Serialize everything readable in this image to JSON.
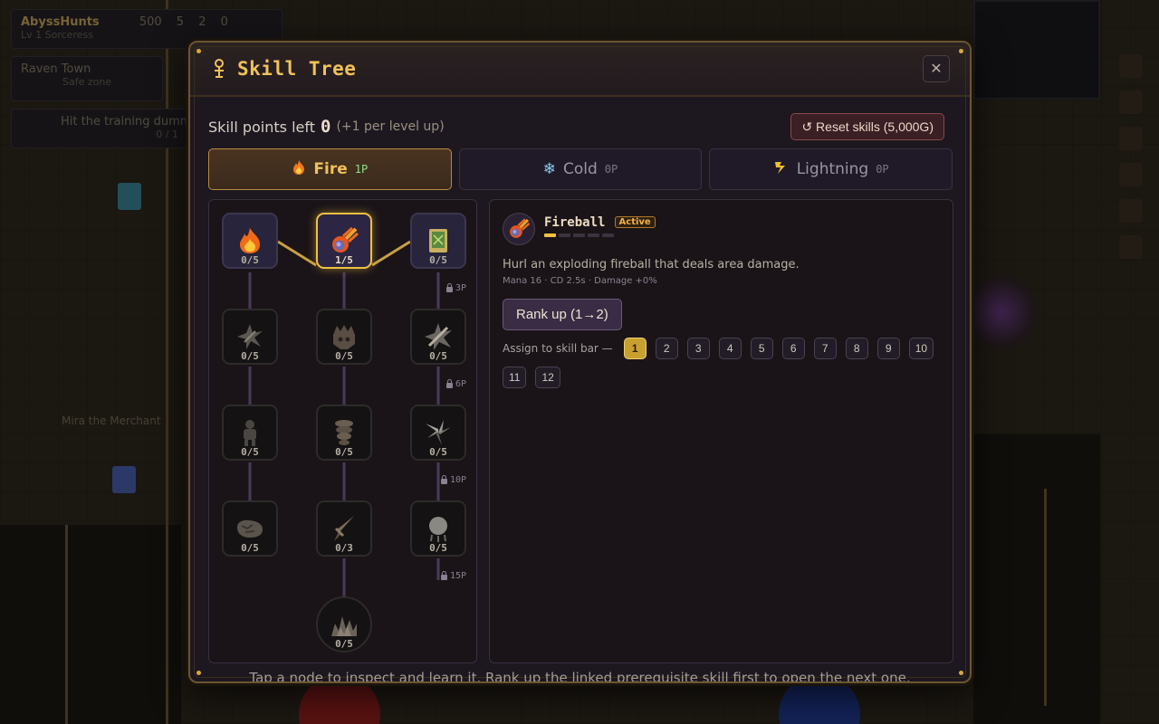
{
  "hud": {
    "player_name": "AbyssHunts",
    "player_class": "Lv 1 Sorceress",
    "gold": "500",
    "res1": "5",
    "res2": "2",
    "res3": "0",
    "zone_name": "Raven Town",
    "zone_sub": "Safe zone",
    "quest_text": "Hit the training dummy",
    "quest_progress": "0 / 1",
    "npc_label": "Mira the Merchant"
  },
  "modal": {
    "title": "Skill Tree",
    "close_label": "✕",
    "points_label": "Skill points left",
    "points_value": "0",
    "points_hint": "(+1 per level up)",
    "reset_label": "↺ Reset skills (5,000G)",
    "footer_hint": "Tap a node to inspect and learn it. Rank up the linked prerequisite skill first to open the next one."
  },
  "tabs": [
    {
      "label": "Fire",
      "points": "1P",
      "icon": "fire-icon",
      "active": true
    },
    {
      "label": "Cold",
      "points": "0P",
      "icon": "snowflake-icon",
      "active": false
    },
    {
      "label": "Lightning",
      "points": "0P",
      "icon": "lightning-icon",
      "active": false
    }
  ],
  "tree": {
    "nodes": [
      {
        "icon": "flame-icon",
        "count": "0/5"
      },
      {
        "icon": "fireball-icon",
        "count": "1/5"
      },
      {
        "icon": "spellbook-icon",
        "count": "0/5"
      },
      {
        "icon": "burst-icon",
        "count": "0/5"
      },
      {
        "icon": "beast-icon",
        "count": "0/5"
      },
      {
        "icon": "sword-burst-icon",
        "count": "0/5"
      },
      {
        "icon": "golem-icon",
        "count": "0/5"
      },
      {
        "icon": "vortex-icon",
        "count": "0/5"
      },
      {
        "icon": "shards-icon",
        "count": "0/5"
      },
      {
        "icon": "boulder-icon",
        "count": "0/5"
      },
      {
        "icon": "blade-icon",
        "count": "0/3"
      },
      {
        "icon": "meteor-icon",
        "count": "0/5"
      },
      {
        "icon": "inferno-icon",
        "count": "0/5"
      }
    ],
    "locks": [
      "3P",
      "6P",
      "10P",
      "15P"
    ]
  },
  "detail": {
    "name": "Fireball",
    "badge": "Active",
    "rank": 1,
    "max_rank": 5,
    "description": "Hurl an exploding fireball that deals area damage.",
    "stats": "Mana 16 · CD 2.5s · Damage +0%",
    "rankup_label": "Rank up (1→2)",
    "assign_label": "Assign to skill bar —",
    "slots": [
      "1",
      "2",
      "3",
      "4",
      "5",
      "6",
      "7",
      "8",
      "9",
      "10",
      "11",
      "12"
    ],
    "active_slot": "1"
  },
  "colors": {
    "accent_gold": "#f0c040",
    "tab_active": "#b88a40",
    "points_green": "#8ee08c",
    "reset_red": "#8a4a48"
  }
}
